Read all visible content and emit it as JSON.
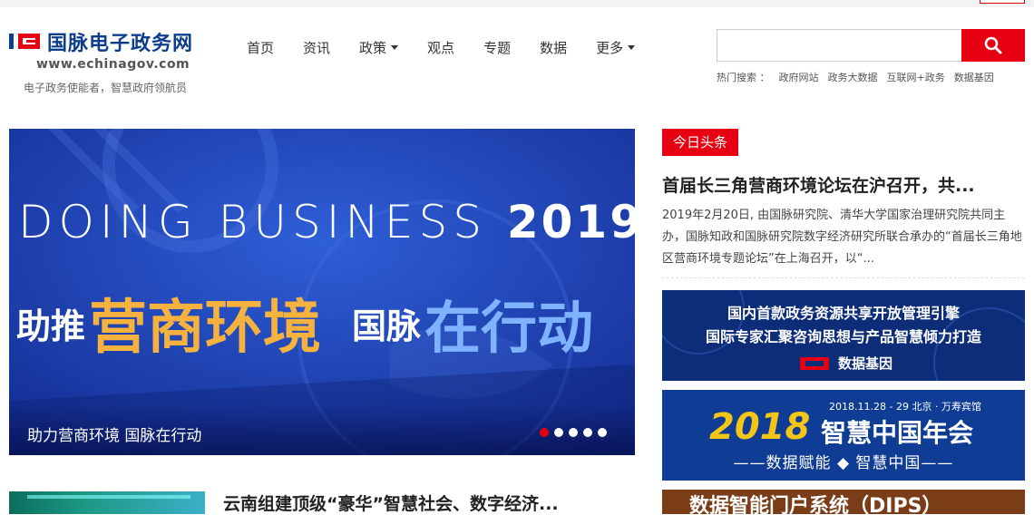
{
  "logo": {
    "title": "国脉电子政务网",
    "url": "www.echinagov.com",
    "slogan": "电子政务使能者，智慧政府领航员"
  },
  "nav": {
    "items": [
      {
        "label": "首页",
        "dropdown": false
      },
      {
        "label": "资讯",
        "dropdown": false
      },
      {
        "label": "政策",
        "dropdown": true
      },
      {
        "label": "观点",
        "dropdown": false
      },
      {
        "label": "专题",
        "dropdown": false
      },
      {
        "label": "数据",
        "dropdown": false
      },
      {
        "label": "更多",
        "dropdown": true
      }
    ]
  },
  "search": {
    "value": "",
    "placeholder": "",
    "button_icon": "search-icon",
    "hot_label": "热门搜索 ：",
    "hot_terms": [
      "政府网站",
      "政务大数据",
      "互联网+政务",
      "数据基因"
    ]
  },
  "banner": {
    "title_en_light": "DOING BUSINESS",
    "title_en_bold": "2019",
    "slogan_part1": "助推",
    "slogan_part2": "营商环境",
    "slogan_part3": "国脉",
    "slogan_part4": "在行动",
    "caption": "助力营商环境 国脉在行动",
    "slide_count": 5,
    "active_slide": 1
  },
  "right": {
    "tag": "今日头条",
    "headline": "首届长三角营商环境论坛在沪召开，共...",
    "summary": "2019年2月20日, 由国脉研究院、清华大学国家治理研究院共同主办，国脉知政和国脉研究院数字经济研究所联合承办的“首届长三角地区营商环境专题论坛”在上海召开，以“...",
    "ad1": {
      "line1": "国内首款政务资源共享开放管理引擎",
      "line2": "国际专家汇聚咨询思想与产品智慧倾力打造",
      "brand": "数据基因"
    },
    "ad2": {
      "date": "2018.11.28 - 29  北京 · 万寿宾馆",
      "year": "2018",
      "title": "智慧中国年会",
      "subtitle": "——数据赋能 ◆ 智慧中国——"
    },
    "ad3": {
      "title": "数据智能门户系统（DIPS）"
    }
  },
  "news": {
    "title": "云南组建顶级“豪华”智慧社会、数字经济..."
  },
  "colors": {
    "accent_red": "#e60012",
    "logo_blue": "#0d3e8c",
    "banner_blue": "#1a3db0",
    "banner_orange": "#f6b23e"
  }
}
